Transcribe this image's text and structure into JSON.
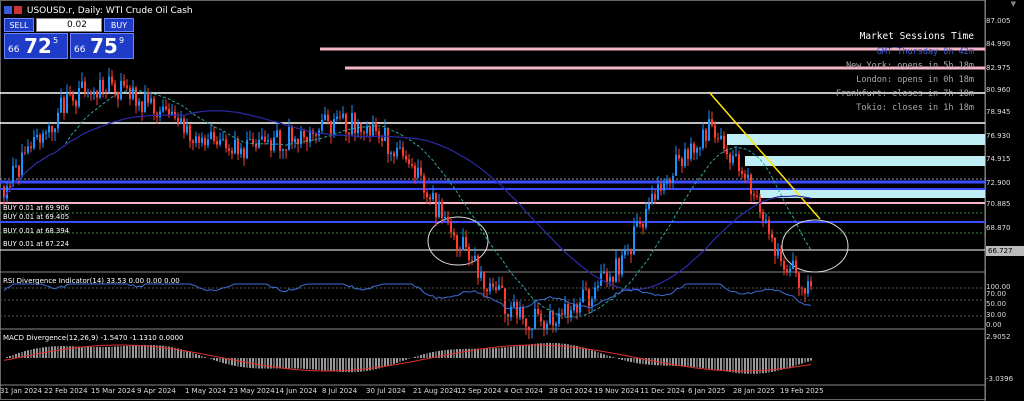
{
  "window": {
    "title": "USOUSD.r, Daily: WTI Crude Oil Cash"
  },
  "trade_panel": {
    "sell_label": "SELL",
    "buy_label": "BUY",
    "lot": "0.02",
    "sell_price": {
      "prefix": "66",
      "big": "72",
      "sup": "5"
    },
    "buy_price": {
      "prefix": "66",
      "big": "75",
      "sup": "9"
    }
  },
  "sessions": {
    "title": "Market Sessions Time",
    "lines": [
      "GMT Thursday 0h 42m",
      "New York: opens in 5h 18m",
      "London: opens in 0h 18m",
      "Frankfurt: closes in 7h 18m",
      "Tokio: closes in 1h 18m"
    ]
  },
  "price_axis": [
    "87.005",
    "84.990",
    "82.975",
    "80.960",
    "78.945",
    "76.930",
    "74.915",
    "72.900",
    "70.885",
    "68.870"
  ],
  "current_price": "66.727",
  "orders": [
    "BUY 0.01 at 69.906",
    "BUY 0.01 at 69.405",
    "BUY 0.01 at 68.394",
    "BUY 0.01 at 67.224"
  ],
  "rsi": {
    "label": "RSI Divergence Indicator(14) 33.53 0.00 0.00 0.00",
    "levels": [
      "100.00",
      "70.00",
      "50.00",
      "30.00",
      "0.00"
    ]
  },
  "macd": {
    "label": "MACD Divergence(12,26,9) -1.5470 -1.1310 0.0000",
    "levels": [
      "2.9052",
      "-3.0396"
    ]
  },
  "date_axis": [
    "31 Jan 2024",
    "22 Feb 2024",
    "15 Mar 2024",
    "9 Apr 2024",
    "1 May 2024",
    "23 May 2024",
    "14 Jun 2024",
    "8 Jul 2024",
    "30 Jul 2024",
    "21 Aug 2024",
    "12 Sep 2024",
    "4 Oct 2024",
    "28 Oct 2024",
    "19 Nov 2024",
    "11 Dec 2024",
    "6 Jan 2025",
    "28 Jan 2025",
    "19 Feb 2025"
  ],
  "colors": {
    "bull": "#1e90ff",
    "bear": "#ff3b30",
    "buttons": "#1e3cc8"
  }
}
